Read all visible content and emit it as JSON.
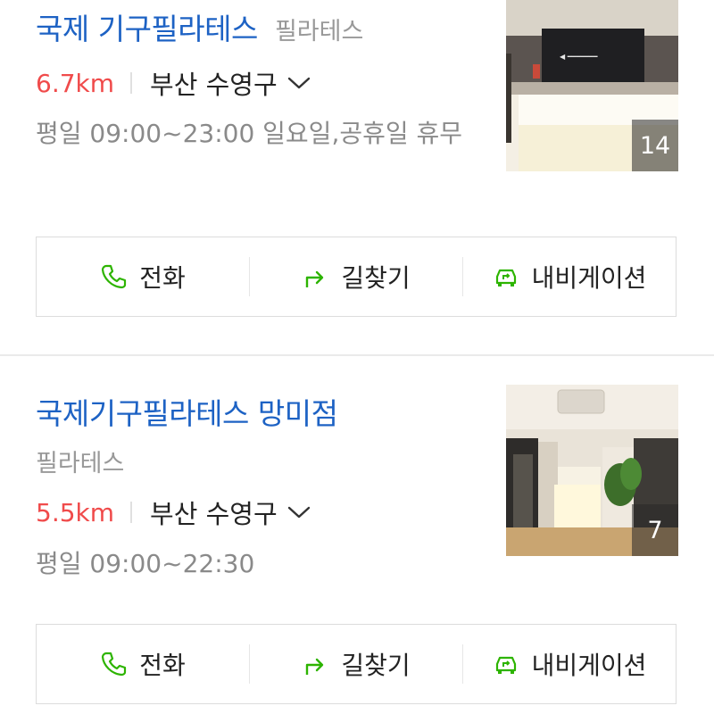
{
  "listings": [
    {
      "name": "국제 기구필라테스",
      "category": "필라테스",
      "distance": "6.7km",
      "region": "부산 수영구",
      "hours": "평일 09:00~23:00 일요일,공휴일 휴무",
      "photo_count": "14"
    },
    {
      "name": "국제기구필라테스 망미점",
      "category": "필라테스",
      "distance": "5.5km",
      "region": "부산 수영구",
      "hours": "평일 09:00~22:30",
      "photo_count": "7"
    }
  ],
  "actions": {
    "call_label": "전화",
    "directions_label": "길찾기",
    "navigation_label": "내비게이션"
  },
  "colors": {
    "title": "#1d62c4",
    "distance": "#f04b4b",
    "action_icon": "#2db400"
  }
}
